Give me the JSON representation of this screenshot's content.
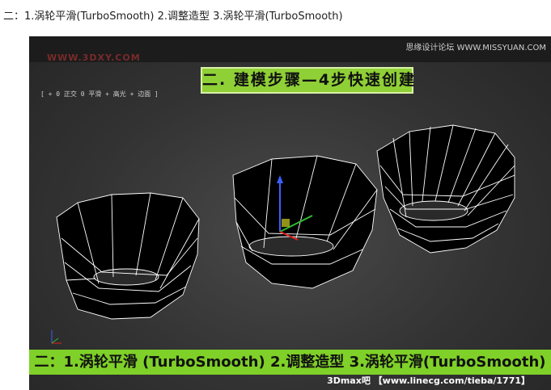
{
  "caption": "二：1.涡轮平滑(TurboSmooth) 2.调整造型 3.涡轮平滑(TurboSmooth)",
  "viewport": {
    "watermark": "WWW.3DXY.COM",
    "site_label": "思缘设计论坛  WWW.MISSYUAN.COM",
    "banner": "二. 建模步骤—4步快速创建",
    "view_label": "[ + 0 正交 0 平滑 + 高光 + 边面 ]",
    "footer": "二：1.涡轮平滑 (TurboSmooth)  2.调整造型   3.涡轮平滑(TurboSmooth)",
    "credit": "3Dmax吧  【www.linecg.com/tieba/1771】"
  },
  "colors": {
    "banner_green": "#8fd036",
    "footer_green": "#7fd028",
    "mesh_fill": "#000000",
    "mesh_wire": "#ffffff"
  },
  "icons": [
    "move-gizmo-icon",
    "axis-tripod-icon"
  ]
}
